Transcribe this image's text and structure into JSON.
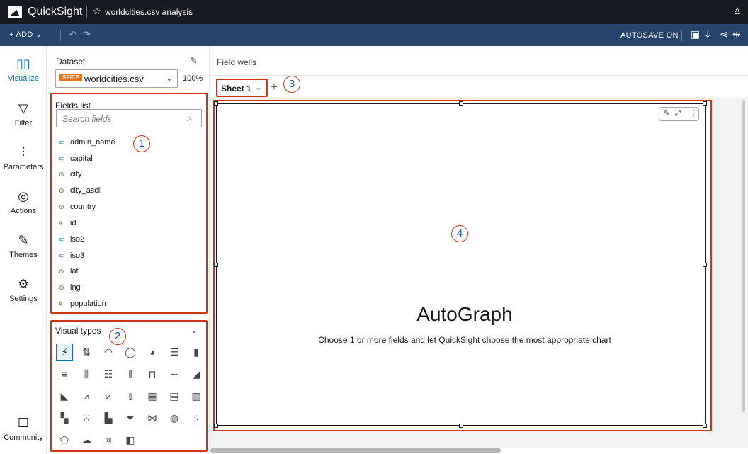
{
  "topbar": {
    "brand": "QuickSight",
    "analysis_title": "worldcities.csv analysis",
    "star_icon": "star-icon",
    "user_icon": "user-icon"
  },
  "toolbar": {
    "add_label": "ADD",
    "autosave_label": "AUTOSAVE ON",
    "icons": [
      "save-icon",
      "download-icon",
      "share-icon",
      "fit-width-icon"
    ]
  },
  "leftnav": {
    "items": [
      {
        "label": "Visualize",
        "icon": "visualize-icon",
        "active": true
      },
      {
        "label": "Filter",
        "icon": "filter-icon"
      },
      {
        "label": "Parameters",
        "icon": "parameters-icon"
      },
      {
        "label": "Actions",
        "icon": "actions-icon"
      },
      {
        "label": "Themes",
        "icon": "themes-icon"
      },
      {
        "label": "Settings",
        "icon": "settings-icon"
      },
      {
        "label": "Community",
        "icon": "community-icon"
      }
    ]
  },
  "dataset": {
    "label": "Dataset",
    "badge": "SPICE",
    "name": "worldcities.csv",
    "percent": "100%"
  },
  "fields": {
    "title": "Fields list",
    "search_placeholder": "Search fields",
    "items": [
      {
        "name": "admin_name",
        "type": "text"
      },
      {
        "name": "capital",
        "type": "text"
      },
      {
        "name": "city",
        "type": "geo"
      },
      {
        "name": "city_ascii",
        "type": "geo"
      },
      {
        "name": "country",
        "type": "geo"
      },
      {
        "name": "id",
        "type": "num"
      },
      {
        "name": "iso2",
        "type": "text"
      },
      {
        "name": "iso3",
        "type": "text"
      },
      {
        "name": "lat",
        "type": "geo"
      },
      {
        "name": "lng",
        "type": "geo"
      },
      {
        "name": "population",
        "type": "num"
      }
    ]
  },
  "visual_types": {
    "title": "Visual types"
  },
  "callouts": [
    "1",
    "2",
    "3",
    "4"
  ],
  "main": {
    "field_wells": "Field wells",
    "sheet_tab": "Sheet 1",
    "autograph_title": "AutoGraph",
    "autograph_subtitle": "Choose 1 or more fields and let QuickSight choose the most appropriate chart"
  },
  "colors": {
    "topbar": "#16191f",
    "toolbar": "#24446c",
    "accent": "#0073bb",
    "highlight_border": "#d13212",
    "spice_badge": "#ec7211",
    "callout_text": "#1a4fd6"
  }
}
